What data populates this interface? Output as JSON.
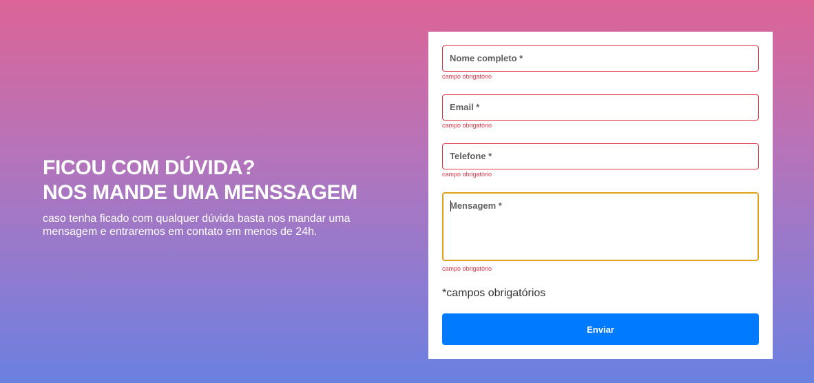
{
  "hero": {
    "heading_line1": "FICOU COM DÚVIDA?",
    "heading_line2": "NOS MANDE UMA MENSSAGEM",
    "subtitle": "caso tenha ficado com qualquer dúvida basta nos mandar uma mensagem e entraremos em contato em menos de 24h."
  },
  "form": {
    "fields": [
      {
        "label": "Nome completo *",
        "error": "campo obrigatório",
        "value": ""
      },
      {
        "label": "Email *",
        "error": "campo obrigatório",
        "value": ""
      },
      {
        "label": "Telefone *",
        "error": "campo obrigatório",
        "value": ""
      },
      {
        "label": "Mensagem *",
        "error": "campo obrigatório",
        "value": ""
      }
    ],
    "required_note": "*campos obrigatórios",
    "submit_label": "Enviar"
  },
  "colors": {
    "gradient_top": "#dc6496",
    "gradient_bottom": "#6a80e0",
    "error": "#dc3545",
    "focus_border": "#e0a21a",
    "button": "#007bff"
  }
}
